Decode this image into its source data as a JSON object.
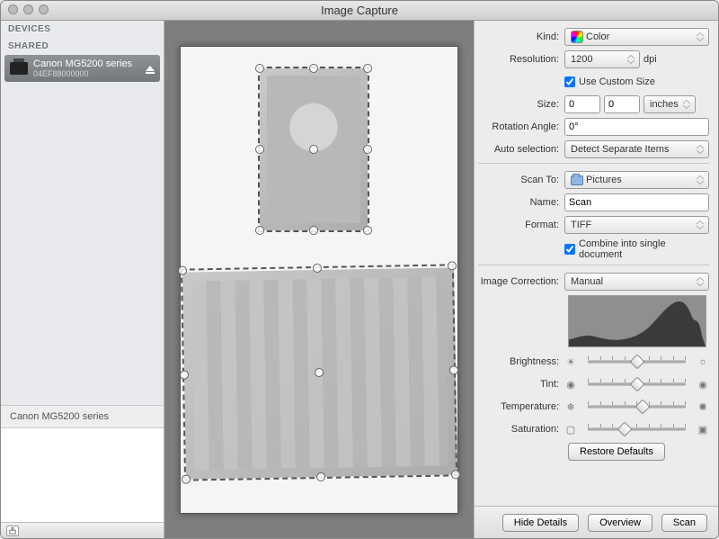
{
  "window": {
    "title": "Image Capture"
  },
  "sidebar": {
    "devices_header": "DEVICES",
    "shared_header": "SHARED",
    "device": {
      "name": "Canon MG5200 series",
      "sub": "04EF88000000"
    },
    "footer_device": "Canon MG5200 series"
  },
  "settings": {
    "kind": {
      "label": "Kind:",
      "value": "Color"
    },
    "resolution": {
      "label": "Resolution:",
      "value": "1200",
      "unit": "dpi"
    },
    "use_custom_size": {
      "label": "Use Custom Size",
      "checked": true
    },
    "size": {
      "label": "Size:",
      "w": "0",
      "h": "0",
      "unit": "inches"
    },
    "rotation": {
      "label": "Rotation Angle:",
      "value": "0°"
    },
    "auto_selection": {
      "label": "Auto selection:",
      "value": "Detect Separate Items"
    },
    "scan_to": {
      "label": "Scan To:",
      "value": "Pictures"
    },
    "name": {
      "label": "Name:",
      "value": "Scan"
    },
    "format": {
      "label": "Format:",
      "value": "TIFF"
    },
    "combine": {
      "label": "Combine into single document",
      "checked": true
    },
    "image_correction": {
      "label": "Image Correction:",
      "value": "Manual"
    },
    "sliders": {
      "brightness": {
        "label": "Brightness:",
        "value": 50
      },
      "tint": {
        "label": "Tint:",
        "value": 50
      },
      "temperature": {
        "label": "Temperature:",
        "value": 55
      },
      "saturation": {
        "label": "Saturation:",
        "value": 40
      }
    },
    "restore_defaults": "Restore Defaults"
  },
  "footer": {
    "hide_details": "Hide Details",
    "overview": "Overview",
    "scan": "Scan"
  }
}
